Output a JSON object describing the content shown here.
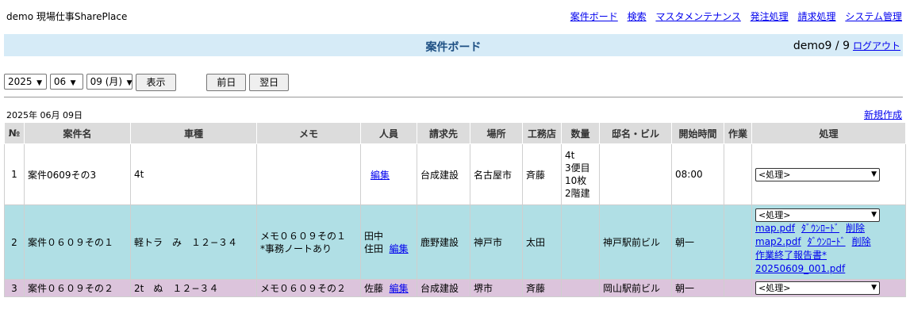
{
  "site": {
    "title": "demo 現場仕事SharePlace"
  },
  "nav": {
    "items": [
      "案件ボード",
      "検索",
      "マスタメンテナンス",
      "発注処理",
      "請求処理",
      "システム管理"
    ]
  },
  "header": {
    "title": "案件ボード",
    "user": "demo9 / 9",
    "logout": "ログアウト"
  },
  "controls": {
    "year": "2025",
    "month": "06",
    "day": "09 (月)",
    "show_label": "表示",
    "prev_label": "前日",
    "next_label": "翌日"
  },
  "list": {
    "date": "2025年 06月 09日",
    "new_label": "新規作成"
  },
  "columns": [
    "№",
    "案件名",
    "車種",
    "メモ",
    "人員",
    "請求先",
    "場所",
    "工務店",
    "数量",
    "邸名・ビル",
    "開始時間",
    "作業",
    "処理"
  ],
  "rows": [
    {
      "no": "1",
      "name": "案件0609その3",
      "vehicle": "4t",
      "memo": "",
      "staff": "",
      "edit": "編集",
      "billing": "台成建設",
      "place": "名古屋市",
      "builder": "斉藤",
      "qty": [
        "4t",
        "3便目",
        "10枚",
        "2階建"
      ],
      "building": "",
      "start": "08:00",
      "work": "",
      "action": "<処理>"
    },
    {
      "no": "2",
      "name": "案件０６０９その１",
      "vehicle": "軽トラ　み　１２−３４",
      "memo": [
        "メモ０６０９その１",
        "*事務ノートあり"
      ],
      "staff": [
        "田中",
        "住田"
      ],
      "edit": "編集",
      "billing": "鹿野建設",
      "place": "神戸市",
      "builder": "太田",
      "qty": [],
      "building": "神戸駅前ビル",
      "start": "朝一",
      "work": "",
      "action": "<処理>",
      "files": [
        {
          "name": "map.pdf",
          "download": "ﾀﾞｳﾝﾛｰﾄﾞ",
          "delete": "削除"
        },
        {
          "name": "map2.pdf",
          "download": "ﾀﾞｳﾝﾛｰﾄﾞ",
          "delete": "削除"
        }
      ],
      "report": [
        "作業終了報告書*",
        "20250609_001.pdf"
      ]
    },
    {
      "no": "3",
      "name": "案件０６０９その２",
      "vehicle": "2t　ぬ　１２−３４",
      "memo": "メモ０６０９その２",
      "staff": "佐藤",
      "edit": "編集",
      "billing": "台成建設",
      "place": "堺市",
      "builder": "斉藤",
      "qty": [],
      "building": "岡山駅前ビル",
      "start": "朝一",
      "work": "",
      "action": "<処理>"
    }
  ],
  "colors": {
    "title_bar": "#d6ebf7",
    "title_text": "#1d4f83",
    "row2_bg": "#b0dfe5",
    "row3_bg": "#dcc4dc",
    "header_bg": "#dcdcdc",
    "link": "#0000ee"
  },
  "icons": {
    "select_arrow": "chevron-down-icon"
  }
}
